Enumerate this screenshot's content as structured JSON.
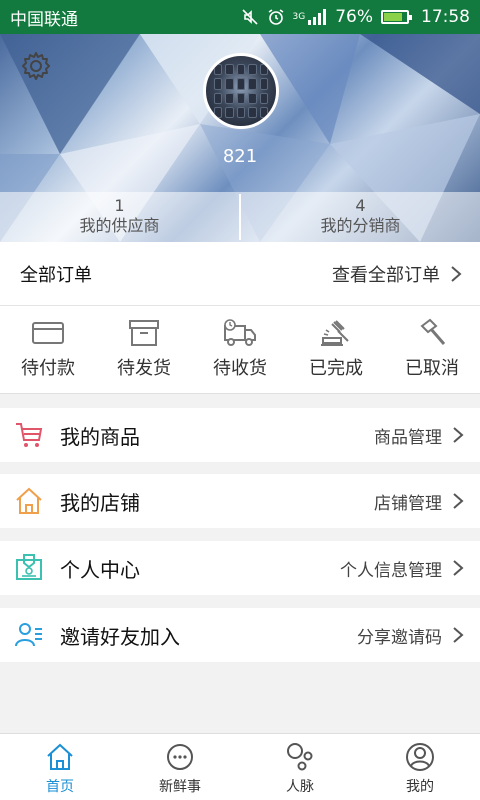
{
  "status": {
    "carrier": "中国联通",
    "network": "3G",
    "battery": "76%",
    "battery_level": 0.76,
    "time": "17:58"
  },
  "profile": {
    "username": "821"
  },
  "stats": [
    {
      "count": "1",
      "label": "我的供应商"
    },
    {
      "count": "4",
      "label": "我的分销商"
    }
  ],
  "orders": {
    "title": "全部订单",
    "view_all": "查看全部订单"
  },
  "order_states": [
    {
      "label": "待付款",
      "icon": "card-icon"
    },
    {
      "label": "待发货",
      "icon": "box-icon"
    },
    {
      "label": "待收货",
      "icon": "truck-icon"
    },
    {
      "label": "已完成",
      "icon": "gavel-icon"
    },
    {
      "label": "已取消",
      "icon": "hammer-icon"
    }
  ],
  "menu": [
    {
      "name": "我的商品",
      "action": "商品管理",
      "icon": "cart-icon",
      "color": "#e0556a"
    },
    {
      "name": "我的店铺",
      "action": "店铺管理",
      "icon": "home-icon",
      "color": "#f0a04b"
    },
    {
      "name": "个人中心",
      "action": "个人信息管理",
      "icon": "id-card-icon",
      "color": "#3cc0b0"
    },
    {
      "name": "邀请好友加入",
      "action": "分享邀请码",
      "icon": "invite-user-icon",
      "color": "#2a9fe0"
    }
  ],
  "tabs": [
    {
      "label": "首页",
      "icon": "home-tab-icon",
      "active": true
    },
    {
      "label": "新鲜事",
      "icon": "chat-dots-icon",
      "active": false
    },
    {
      "label": "人脉",
      "icon": "network-icon",
      "active": false
    },
    {
      "label": "我的",
      "icon": "user-icon",
      "active": false
    }
  ],
  "colors": {
    "status_bar": "#127a3e",
    "accent": "#1a8fd6"
  }
}
